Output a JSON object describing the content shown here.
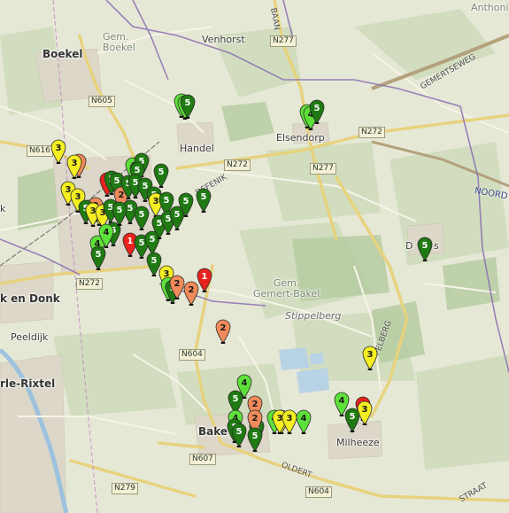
{
  "map": {
    "places": [
      {
        "key": "boekel",
        "label": "Boekel",
        "cls": "big"
      },
      {
        "key": "gem-boekel",
        "label": "Gem.\nBoekel",
        "cls": "area"
      },
      {
        "key": "venhorst",
        "label": "Venhorst",
        "cls": ""
      },
      {
        "key": "handel",
        "label": "Handel",
        "cls": ""
      },
      {
        "key": "elsendorp",
        "label": "Elsendorp",
        "cls": ""
      },
      {
        "key": "anthonis",
        "label": "Anthonis",
        "cls": "area"
      },
      {
        "key": "gem-gemert",
        "label": "Gem.\nGemert-Bakel",
        "cls": "area"
      },
      {
        "key": "stippelberg",
        "label": "Stippelberg",
        "cls": "italic"
      },
      {
        "key": "peeldijk",
        "label": "Peeldijk",
        "cls": ""
      },
      {
        "key": "aa-en-donk",
        "label": "k en Donk",
        "cls": "big"
      },
      {
        "key": "rle-rixtel",
        "label": "rle-Rixtel",
        "cls": "big"
      },
      {
        "key": "bakel",
        "label": "Bake",
        "cls": "big"
      },
      {
        "key": "milheeze",
        "label": "Milheeze",
        "cls": ""
      },
      {
        "key": "deurne-k",
        "label": "k",
        "cls": ""
      },
      {
        "key": "d-place",
        "label": "D",
        "cls": ""
      },
      {
        "key": "s-place",
        "label": "s",
        "cls": ""
      }
    ],
    "roads": [
      {
        "key": "n605",
        "label": "N605"
      },
      {
        "key": "n277a",
        "label": "N277"
      },
      {
        "key": "n616",
        "label": "N616"
      },
      {
        "key": "n272a",
        "label": "N272"
      },
      {
        "key": "n272b",
        "label": "N272"
      },
      {
        "key": "n277b",
        "label": "N277"
      },
      {
        "key": "n272c",
        "label": "N272"
      },
      {
        "key": "n604a",
        "label": "N604"
      },
      {
        "key": "n607",
        "label": "N607"
      },
      {
        "key": "n279",
        "label": "N279"
      },
      {
        "key": "n604b",
        "label": "N604"
      }
    ],
    "street_labels": [
      {
        "key": "gemertseweg",
        "label": "GEMERTSEWEG"
      },
      {
        "key": "noord",
        "label": "NOORD"
      },
      {
        "key": "peelberg",
        "label": "PELBERG"
      },
      {
        "key": "oldert",
        "label": "OLDERT"
      },
      {
        "key": "straat",
        "label": "STRAAT"
      },
      {
        "key": "defenik",
        "label": "DEFENIK"
      },
      {
        "key": "bahn",
        "label": "BAAN"
      }
    ],
    "marker_colors": {
      "1": "#e8221c",
      "2": "#f08a5a",
      "3": "#f4ee22",
      "4": "#5ee03a",
      "5": "#1f7a12",
      "6": "#0d4a08"
    },
    "markers": [
      {
        "n": "4"
      },
      {
        "n": "4"
      },
      {
        "n": "5"
      },
      {
        "n": "4"
      },
      {
        "n": "4"
      },
      {
        "n": "5"
      },
      {
        "n": "3"
      },
      {
        "n": "2"
      },
      {
        "n": "3"
      },
      {
        "n": "3"
      },
      {
        "n": "3"
      },
      {
        "n": "3"
      },
      {
        "n": "2"
      },
      {
        "n": "1"
      },
      {
        "n": "5"
      },
      {
        "n": "5"
      },
      {
        "n": "4"
      },
      {
        "n": "5"
      },
      {
        "n": "5"
      },
      {
        "n": "5"
      },
      {
        "n": "2"
      },
      {
        "n": "5"
      },
      {
        "n": "5"
      },
      {
        "n": "5"
      },
      {
        "n": "5"
      },
      {
        "n": "3"
      },
      {
        "n": "3"
      },
      {
        "n": "5"
      },
      {
        "n": "5"
      },
      {
        "n": "5"
      },
      {
        "n": "3"
      },
      {
        "n": "5"
      },
      {
        "n": "5"
      },
      {
        "n": "4"
      },
      {
        "n": "5"
      },
      {
        "n": "5"
      },
      {
        "n": "1"
      },
      {
        "n": "5"
      },
      {
        "n": "5"
      },
      {
        "n": "5"
      },
      {
        "n": "5"
      },
      {
        "n": "5"
      },
      {
        "n": "5"
      },
      {
        "n": "5"
      },
      {
        "n": "4"
      },
      {
        "n": "5"
      },
      {
        "n": "5"
      },
      {
        "n": "3"
      },
      {
        "n": "4"
      },
      {
        "n": "5"
      },
      {
        "n": "2"
      },
      {
        "n": "1"
      },
      {
        "n": "2"
      },
      {
        "n": "2"
      },
      {
        "n": "5"
      },
      {
        "n": "3"
      },
      {
        "n": "4"
      },
      {
        "n": "5"
      },
      {
        "n": "3"
      },
      {
        "n": "1"
      },
      {
        "n": "5"
      },
      {
        "n": "3"
      },
      {
        "n": "4"
      },
      {
        "n": "2"
      },
      {
        "n": "2"
      },
      {
        "n": "4"
      },
      {
        "n": "3"
      },
      {
        "n": "3"
      },
      {
        "n": "4"
      },
      {
        "n": "5"
      },
      {
        "n": "5"
      },
      {
        "n": "5"
      },
      {
        "n": "4"
      },
      {
        "n": "5"
      }
    ]
  }
}
